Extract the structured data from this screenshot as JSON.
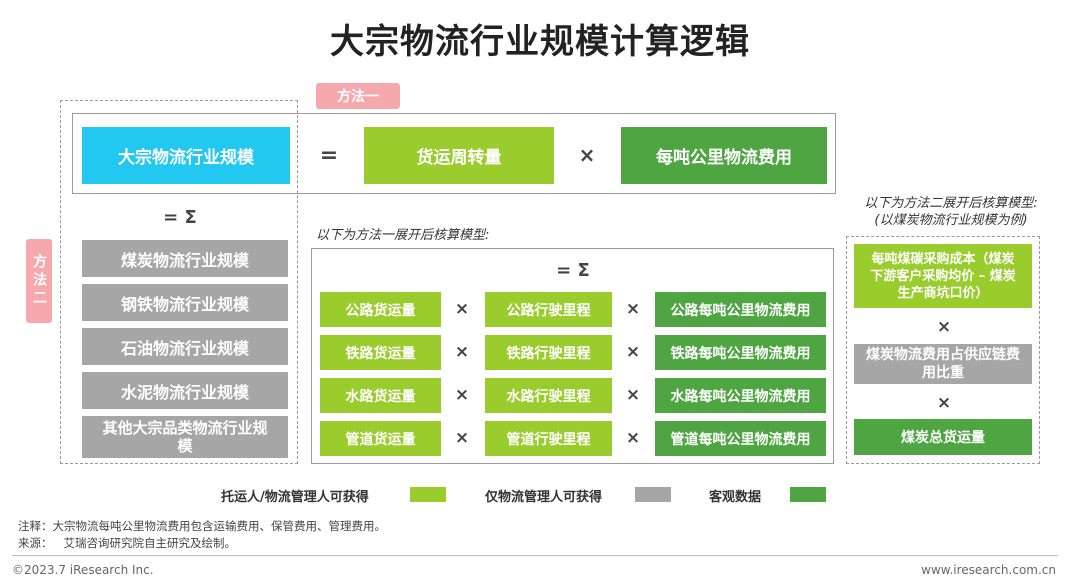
{
  "title": "大宗物流行业规模计算逻辑",
  "method1": {
    "tag": "方法一",
    "total": "大宗物流行业规模",
    "eq": "=",
    "factor1": "货运周转量",
    "times": "×",
    "factor2": "每吨公里物流费用"
  },
  "method2": {
    "tag": "方法二",
    "sum": "= Σ",
    "items": [
      "煤炭物流行业规模",
      "钢铁物流行业规模",
      "石油物流行业规模",
      "水泥物流行业规模",
      "其他大宗品类物流行业规模"
    ]
  },
  "expansion1": {
    "note": "以下为方法一展开后核算模型:",
    "sum": "= Σ",
    "rows": [
      {
        "volume": "公路货运量",
        "distance": "公路行驶里程",
        "cost": "公路每吨公里物流费用"
      },
      {
        "volume": "铁路货运量",
        "distance": "铁路行驶里程",
        "cost": "铁路每吨公里物流费用"
      },
      {
        "volume": "水路货运量",
        "distance": "水路行驶里程",
        "cost": "水路每吨公里物流费用"
      },
      {
        "volume": "管道货运量",
        "distance": "管道行驶里程",
        "cost": "管道每吨公里物流费用"
      }
    ],
    "times": "×"
  },
  "expansion2": {
    "note_line1": "以下为方法二展开后核算模型:",
    "note_line2": "(以煤炭物流行业规模为例)",
    "box1": "每吨煤碳采购成本（煤炭下游客户采购均价 – 煤炭生产商坑口价）",
    "box2": "煤炭物流费用占供应链费用比重",
    "box3": "煤炭总货运量",
    "times": "×"
  },
  "legend": {
    "item1": "托运人/物流管理人可获得",
    "item2": "仅物流管理人可获得",
    "item3": "客观数据",
    "colors": {
      "lime": "#9acc2e",
      "gray": "#a6a6a6",
      "green": "#4ea542",
      "cyan": "#22c8f0",
      "pink": "#f6a9ad"
    }
  },
  "notes": {
    "note": "注释：大宗物流每吨公里物流费用包含运输费用、保管费用、管理费用。",
    "source": "来源：   艾瑞咨询研究院自主研究及绘制。"
  },
  "footer": {
    "left": "©2023.7 iResearch Inc.",
    "right": "www.iresearch.com.cn"
  }
}
